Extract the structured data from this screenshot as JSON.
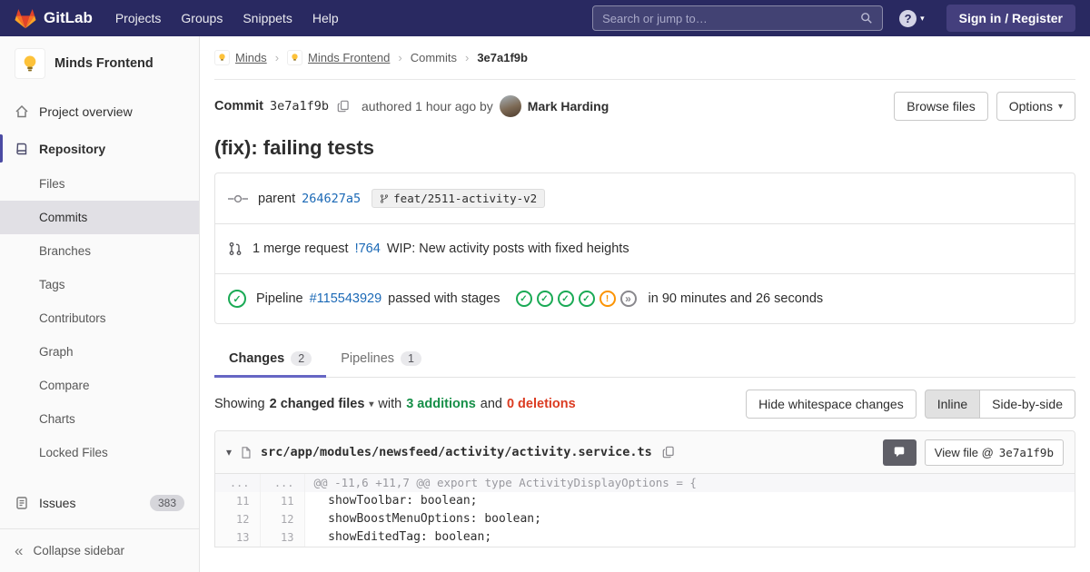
{
  "colors": {
    "navbar_bg": "#292961",
    "accent": "#6666c4",
    "link_blue": "#1b69b6",
    "success_green": "#1aaa55",
    "warning_orange": "#fc9403",
    "additions_green": "#168f48",
    "deletions_red": "#db3b21"
  },
  "navbar": {
    "brand": "GitLab",
    "items": [
      "Projects",
      "Groups",
      "Snippets",
      "Help"
    ],
    "search_placeholder": "Search or jump to…",
    "sign_in_label": "Sign in / Register"
  },
  "sidebar": {
    "project_name": "Minds Frontend",
    "project_overview_label": "Project overview",
    "repository_label": "Repository",
    "repo_items": [
      "Files",
      "Commits",
      "Branches",
      "Tags",
      "Contributors",
      "Graph",
      "Compare",
      "Charts",
      "Locked Files"
    ],
    "active_repo_item": "Commits",
    "issues_label": "Issues",
    "issues_count": "383",
    "collapse_label": "Collapse sidebar"
  },
  "breadcrumb": [
    "Minds",
    "Minds Frontend",
    "Commits",
    "3e7a1f9b"
  ],
  "commit": {
    "label": "Commit",
    "sha": "3e7a1f9b",
    "authored_text": "authored 1 hour ago by",
    "author": "Mark Harding",
    "browse_files_label": "Browse files",
    "options_label": "Options",
    "title": "(fix): failing tests",
    "parent_label": "parent",
    "parent_sha": "264627a5",
    "branch_name": "feat/2511-activity-v2",
    "merge_request": {
      "count_text": "1 merge request",
      "ref": "!764",
      "title": "WIP: New activity posts with fixed heights"
    },
    "pipeline": {
      "label": "Pipeline",
      "id": "#115543929",
      "status_text": "passed with stages",
      "stages": [
        "success",
        "success",
        "success",
        "success",
        "warning",
        "manual"
      ],
      "duration_text": "in 90 minutes and 26 seconds"
    }
  },
  "tabs": [
    {
      "label": "Changes",
      "count": "2",
      "active": true
    },
    {
      "label": "Pipelines",
      "count": "1",
      "active": false
    }
  ],
  "diff_summary": {
    "showing_text": "Showing",
    "files_toggle": "2 changed files",
    "with_text": "with",
    "additions_text": "3 additions",
    "and_text": "and",
    "deletions_text": "0 deletions",
    "hide_whitespace_label": "Hide whitespace changes",
    "inline_label": "Inline",
    "side_by_side_label": "Side-by-side"
  },
  "diff_file": {
    "path": "src/app/modules/newsfeed/activity/activity.service.ts",
    "view_file_label": "View file @",
    "view_file_sha": "3e7a1f9b",
    "hunk_ellipsis": "...",
    "hunk_header": "@@ -11,6 +11,7 @@ export type ActivityDisplayOptions = {",
    "lines": [
      {
        "old_line": "11",
        "new_line": "11",
        "code": "  showToolbar: boolean;"
      },
      {
        "old_line": "12",
        "new_line": "12",
        "code": "  showBoostMenuOptions: boolean;"
      },
      {
        "old_line": "13",
        "new_line": "13",
        "code": "  showEditedTag: boolean;"
      }
    ]
  }
}
